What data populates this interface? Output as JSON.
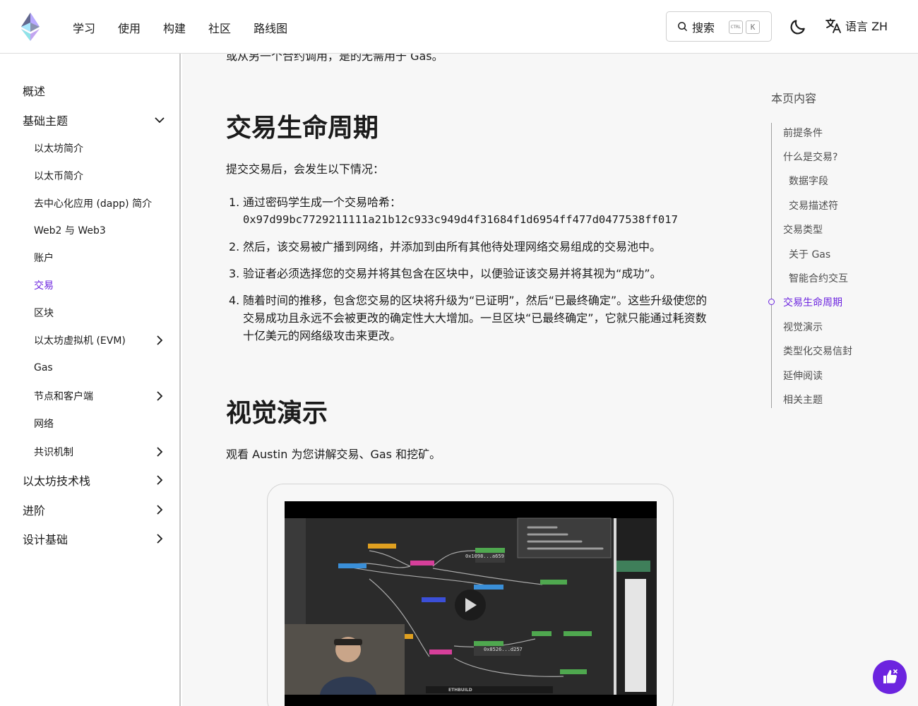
{
  "header": {
    "logo_icon": "ethereum-logo-icon",
    "nav": [
      "学习",
      "使用",
      "构建",
      "社区",
      "路线图"
    ],
    "search": {
      "label": "搜索",
      "kbd_ctrl": "CTRL",
      "kbd_k": "K"
    },
    "theme_icon": "moon-icon",
    "language": {
      "icon": "translate-icon",
      "label": "语言 ZH"
    }
  },
  "sidebar": {
    "items": [
      {
        "label": "概述",
        "level": 1,
        "chevron": "none"
      },
      {
        "label": "基础主题",
        "level": 1,
        "chevron": "down"
      },
      {
        "label": "以太坊简介",
        "level": 2,
        "chevron": "none"
      },
      {
        "label": "以太币简介",
        "level": 2,
        "chevron": "none"
      },
      {
        "label": "去中心化应用 (dapp) 简介",
        "level": 2,
        "chevron": "none"
      },
      {
        "label": "Web2 与 Web3",
        "level": 2,
        "chevron": "none"
      },
      {
        "label": "账户",
        "level": 2,
        "chevron": "none"
      },
      {
        "label": "交易",
        "level": 2,
        "chevron": "none",
        "active": true
      },
      {
        "label": "区块",
        "level": 2,
        "chevron": "none"
      },
      {
        "label": "以太坊虚拟机 (EVM)",
        "level": 2,
        "chevron": "right"
      },
      {
        "label": "Gas",
        "level": 2,
        "chevron": "none"
      },
      {
        "label": "节点和客户端",
        "level": 2,
        "chevron": "right"
      },
      {
        "label": "网络",
        "level": 2,
        "chevron": "none"
      },
      {
        "label": "共识机制",
        "level": 2,
        "chevron": "right"
      },
      {
        "label": "以太坊技术栈",
        "level": 1,
        "chevron": "right"
      },
      {
        "label": "进阶",
        "level": 1,
        "chevron": "right"
      },
      {
        "label": "设计基础",
        "level": 1,
        "chevron": "right"
      }
    ]
  },
  "main": {
    "cut_text": "或从另一个合约调用，是的无需用于 Gas。",
    "lifecycle_heading": "交易生命周期",
    "lifecycle_intro": "提交交易后，会发生以下情况：",
    "steps": [
      {
        "num": "1.",
        "text": "通过密码学生成一个交易哈希：",
        "hash": "0x97d99bc7729211111a21b12c933c949d4f31684f1d6954ff477d0477538ff017"
      },
      {
        "num": "2.",
        "text": "然后，该交易被广播到网络，并添加到由所有其他待处理网络交易组成的交易池中。"
      },
      {
        "num": "3.",
        "text": "验证者必须选择您的交易并将其包含在区块中，以便验证该交易并将其视为“成功”。"
      },
      {
        "num": "4.",
        "text": "随着时间的推移，包含您交易的区块将升级为“已证明”，然后“已最终确定”。这些升级使您的交易成功且永远不会被更改的确定性大大增加。一旦区块“已最终确定”，它就只能通过耗资数十亿美元的网络级攻击来更改。"
      }
    ],
    "visual_heading": "视觉演示",
    "visual_intro": "观看 Austin 为您讲解交易、Gas 和挖矿。",
    "video": {
      "play_icon": "play-icon",
      "address_1": "0x1098...a659",
      "address_2": "0x8526...d257",
      "brand": "ETHBUILD"
    }
  },
  "toc": {
    "title": "本页内容",
    "items": [
      {
        "label": "前提条件",
        "level": 1
      },
      {
        "label": "什么是交易?",
        "level": 1
      },
      {
        "label": "数据字段",
        "level": 2
      },
      {
        "label": "交易描述符",
        "level": 2
      },
      {
        "label": "交易类型",
        "level": 1
      },
      {
        "label": "关于 Gas",
        "level": 2
      },
      {
        "label": "智能合约交互",
        "level": 2
      },
      {
        "label": "交易生命周期",
        "level": 1,
        "active": true
      },
      {
        "label": "视觉演示",
        "level": 1
      },
      {
        "label": "类型化交易信封",
        "level": 1
      },
      {
        "label": "延伸阅读",
        "level": 1
      },
      {
        "label": "相关主题",
        "level": 1
      }
    ]
  },
  "feedback": {
    "icon": "thumbs-feedback-icon"
  },
  "colors": {
    "accent": "#6c24df",
    "text": "#1b1b1b",
    "muted": "#4e4e4e",
    "main_bg": "#f7f7f7"
  }
}
